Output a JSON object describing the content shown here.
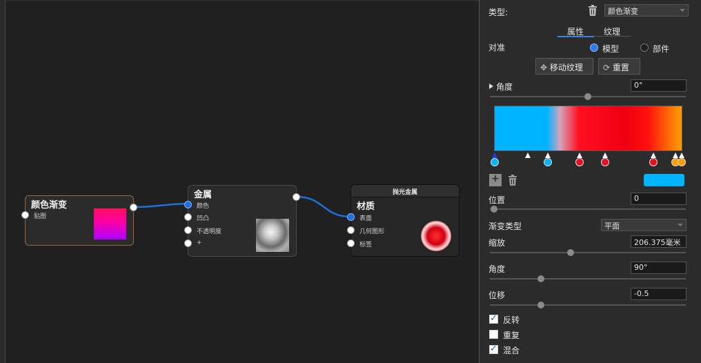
{
  "graph": {
    "nodes": {
      "gradient": {
        "title": "颜色渐变",
        "ports": [
          "贴图"
        ]
      },
      "metal": {
        "title": "金属",
        "ports": [
          "颜色",
          "凹凸",
          "不透明度",
          "+"
        ]
      },
      "material": {
        "header": "抛光金属",
        "title": "材质",
        "ports": [
          "表面",
          "几何图形",
          "标签"
        ]
      }
    }
  },
  "panel": {
    "type_label": "类型:",
    "type_value": "颜色渐变",
    "tabs": [
      "属性",
      "纹理"
    ],
    "align_label": "对准",
    "align_options": [
      "模型",
      "部件"
    ],
    "align_selected": "模型",
    "move_texture_button": "移动纹理",
    "reset_button": "重置",
    "angle_label": "角度",
    "angle_value": "0°",
    "ramp_stops": [
      "#00b4ff",
      "#00b4ff",
      "#e81020",
      "#e81020",
      "#e81020",
      "#ff9a00",
      "#ff9a00"
    ],
    "active_color": "#00b4ff",
    "position_label": "位置",
    "position_value": "0",
    "gradient_type_label": "渐变类型",
    "gradient_type_value": "平面",
    "scale_label": "缩放",
    "scale_value": "206.375毫米",
    "angle2_label": "角度",
    "angle2_value": "90°",
    "offset_label": "位移",
    "offset_value": "-0.5",
    "checkboxes": [
      {
        "label": "反转",
        "checked": true
      },
      {
        "label": "重复",
        "checked": false
      },
      {
        "label": "混合",
        "checked": true
      }
    ]
  }
}
